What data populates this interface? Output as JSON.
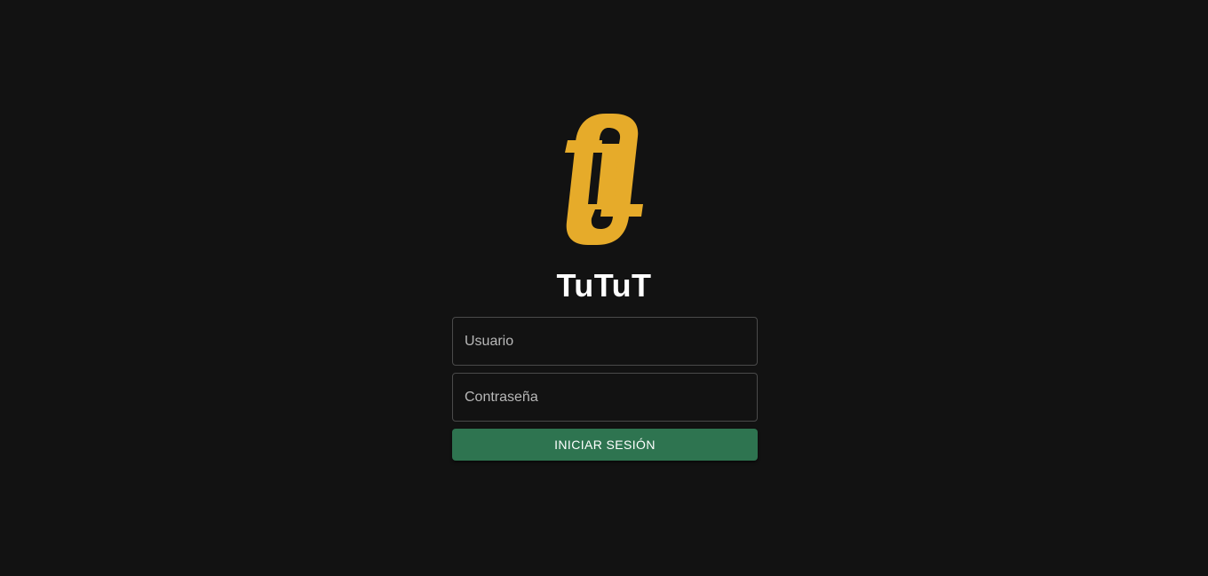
{
  "app": {
    "name": "TuTuT",
    "logo_icon": "tutut-logo-icon",
    "accent_color": "#e6ab2a"
  },
  "login_form": {
    "username_placeholder": "Usuario",
    "password_placeholder": "Contraseña",
    "submit_label": "INICIAR SESIÓN",
    "submit_color": "#2e7450"
  }
}
